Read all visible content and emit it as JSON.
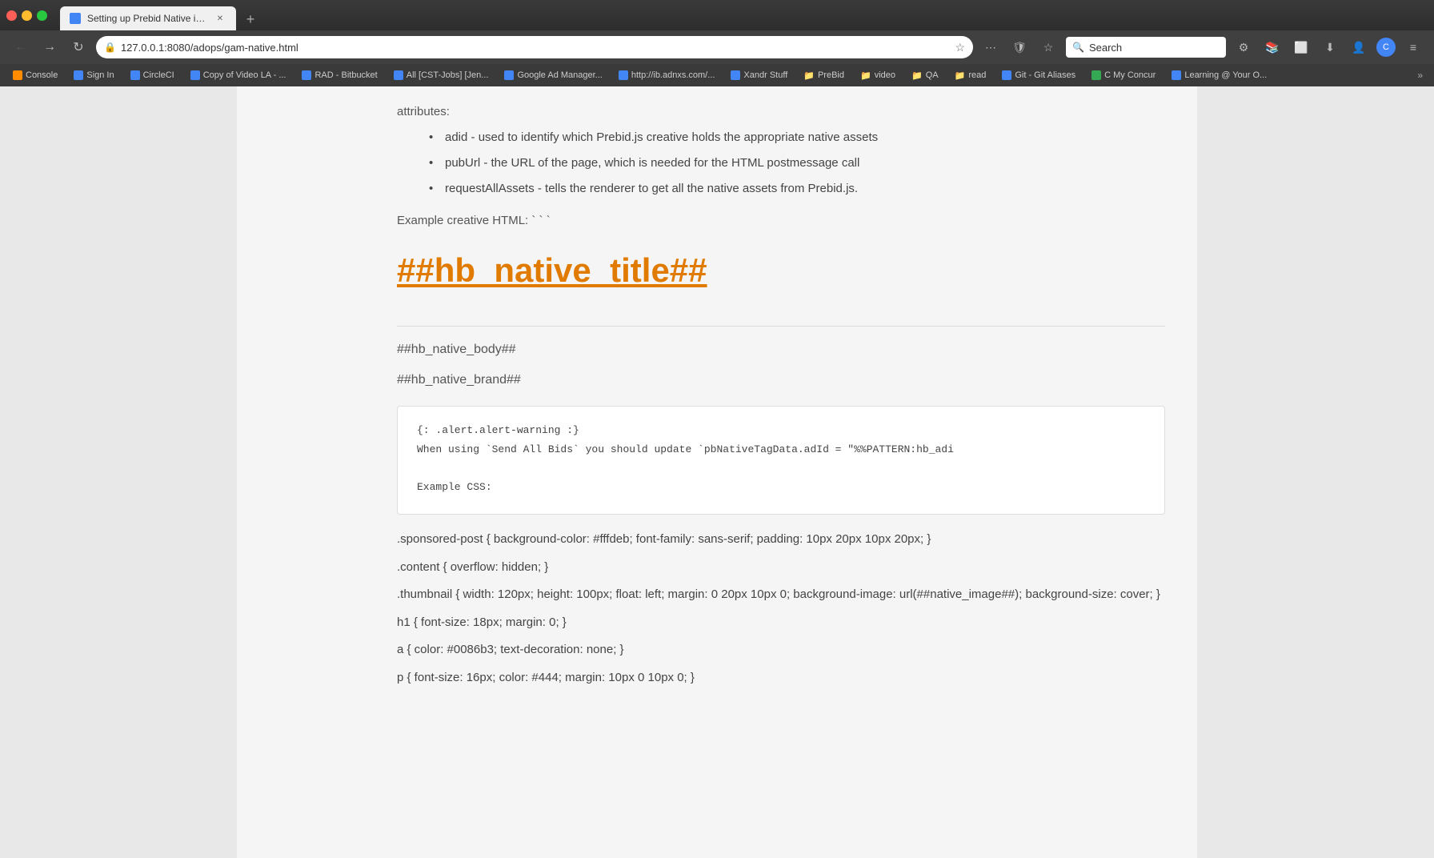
{
  "browser": {
    "title_bar": {
      "tab_title": "Setting up Prebid Native in Google...",
      "new_tab_label": "+"
    },
    "nav": {
      "address": "127.0.0.1:8080/adops/gam-native.html",
      "search_placeholder": "Search"
    },
    "bookmarks": [
      {
        "id": "console",
        "label": "Console",
        "color": "bm-orange"
      },
      {
        "id": "signin",
        "label": "Sign In",
        "color": "bm-blue"
      },
      {
        "id": "circleci",
        "label": "CircleCI",
        "color": "bm-blue"
      },
      {
        "id": "video-la",
        "label": "Copy of Video LA - ...",
        "color": "bm-blue"
      },
      {
        "id": "rad-bitbucket",
        "label": "RAD - Bitbucket",
        "color": "bm-blue"
      },
      {
        "id": "cst-jobs",
        "label": "All [CST-Jobs] [Jen...",
        "color": "bm-blue"
      },
      {
        "id": "gam",
        "label": "Google Ad Manager...",
        "color": "bm-blue"
      },
      {
        "id": "adnxs",
        "label": "http://ib.adnxs.com/...",
        "color": "bm-blue"
      },
      {
        "id": "xandr",
        "label": "Xandr Stuff",
        "color": "bm-blue"
      },
      {
        "id": "prebid",
        "label": "PreBid",
        "color": "bm-folder"
      },
      {
        "id": "video",
        "label": "video",
        "color": "bm-folder"
      },
      {
        "id": "qa",
        "label": "QA",
        "color": "bm-folder"
      },
      {
        "id": "read",
        "label": "read",
        "color": "bm-folder"
      },
      {
        "id": "git",
        "label": "Git - Git Aliases",
        "color": "bm-blue"
      },
      {
        "id": "concur",
        "label": "C My Concur",
        "color": "bm-blue"
      },
      {
        "id": "learning",
        "label": "Learning @ Your O...",
        "color": "bm-blue"
      }
    ]
  },
  "content": {
    "intro_bullets": [
      "adid - used to identify which Prebid.js creative holds the appropriate native assets",
      "pubUrl - the URL of the page, which is needed for the HTML postmessage call",
      "requestAllAssets - tells the renderer to get all the native assets from Prebid.js."
    ],
    "example_label": "Example creative HTML: ` ` `",
    "native_title": "##hb_native_title##",
    "native_body": "##hb_native_body##",
    "native_brand": "##hb_native_brand##",
    "code_block": {
      "line1": "{: .alert.alert-warning :}",
      "line2": "When using `Send All Bids` you should update `pbNativeTagData.adId = \"%%PATTERN:hb_adi",
      "line3": "",
      "line4": "Example CSS:"
    },
    "css_lines": [
      ".sponsored-post { background-color: #fffdeb; font-family: sans-serif; padding: 10px 20px 10px 20px; }",
      ".content { overflow: hidden; }",
      ".thumbnail { width: 120px; height: 100px; float: left; margin: 0 20px 10px 0; background-image: url(##native_image##); background-size: cover; }",
      "h1 { font-size: 18px; margin: 0; }",
      "a { color: #0086b3; text-decoration: none; }",
      "p { font-size: 16px; color: #444; margin: 10px 0 10px 0; }"
    ]
  }
}
